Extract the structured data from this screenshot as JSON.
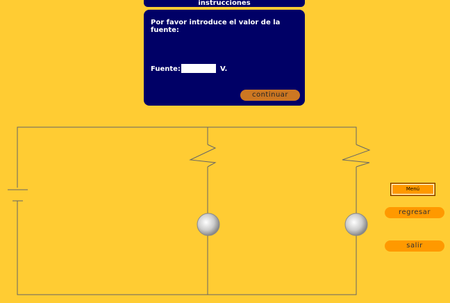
{
  "dialog": {
    "title": "instrucciones",
    "prompt": "Por favor introduce el valor de la fuente:",
    "field_label": "Fuente:",
    "field_value": "",
    "unit": "V.",
    "continue_label": "continuar"
  },
  "side": {
    "menu_label": "Menú",
    "back_label": "regresar",
    "exit_label": "salir"
  },
  "colors": {
    "background": "#FFCC33",
    "dialog": "#000066",
    "button": "#FF9900",
    "wire": "#666666"
  },
  "circuit": {
    "components": [
      "battery-icon",
      "resistor-icon",
      "resistor-icon",
      "bulb-icon",
      "bulb-icon"
    ]
  }
}
